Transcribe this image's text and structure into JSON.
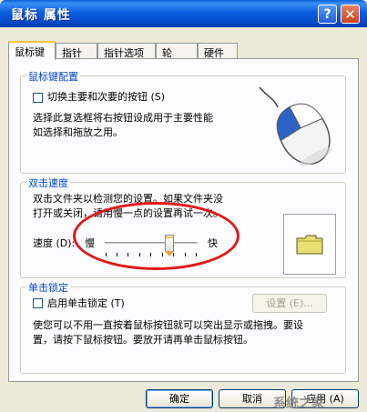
{
  "window": {
    "title": "鼠标 属性",
    "help_label": "?",
    "close_label": "✕"
  },
  "tabs": [
    {
      "label": "鼠标键",
      "active": true
    },
    {
      "label": "指针",
      "active": false
    },
    {
      "label": "指针选项",
      "active": false
    },
    {
      "label": "轮",
      "active": false
    },
    {
      "label": "硬件",
      "active": false
    }
  ],
  "button_config": {
    "title": "鼠标键配置",
    "checkbox_label": "切换主要和次要的按钮 (S)",
    "checkbox_checked": false,
    "description_line1": "选择此复选框将右按钮设成用于主要性能",
    "description_line2": "如选择和拖放之用。",
    "mouse_icon": "mouse-icon"
  },
  "double_click": {
    "title": "双击速度",
    "description_line1": "双击文件夹以检测您的设置。如果文件夹没",
    "description_line2": "打开或关闭，请用慢一点的设置再试一次。",
    "speed_label": "速度 (D):",
    "slow_label": "慢",
    "fast_label": "快",
    "speed_level": 0.7,
    "test_folder_icon": "folder-icon"
  },
  "click_lock": {
    "title": "单击锁定",
    "checkbox_label": "启用单击锁定 (T)",
    "checkbox_checked": false,
    "settings_button": "设置 (E)...",
    "description_line1": "使您可以不用一直按着鼠标按钮就可以突出显示或拖拽。要设",
    "description_line2": "置，请按下鼠标按钮。要放开请再单击鼠标按钮。"
  },
  "footer": {
    "ok": "确定",
    "cancel": "取消",
    "apply": "应用 (A)"
  },
  "watermark": "系统之家",
  "colors": {
    "titlebar": "#0a5fd8",
    "group_title": "#0046d5",
    "annotation": "#e11818",
    "folder": "#e8e070"
  }
}
